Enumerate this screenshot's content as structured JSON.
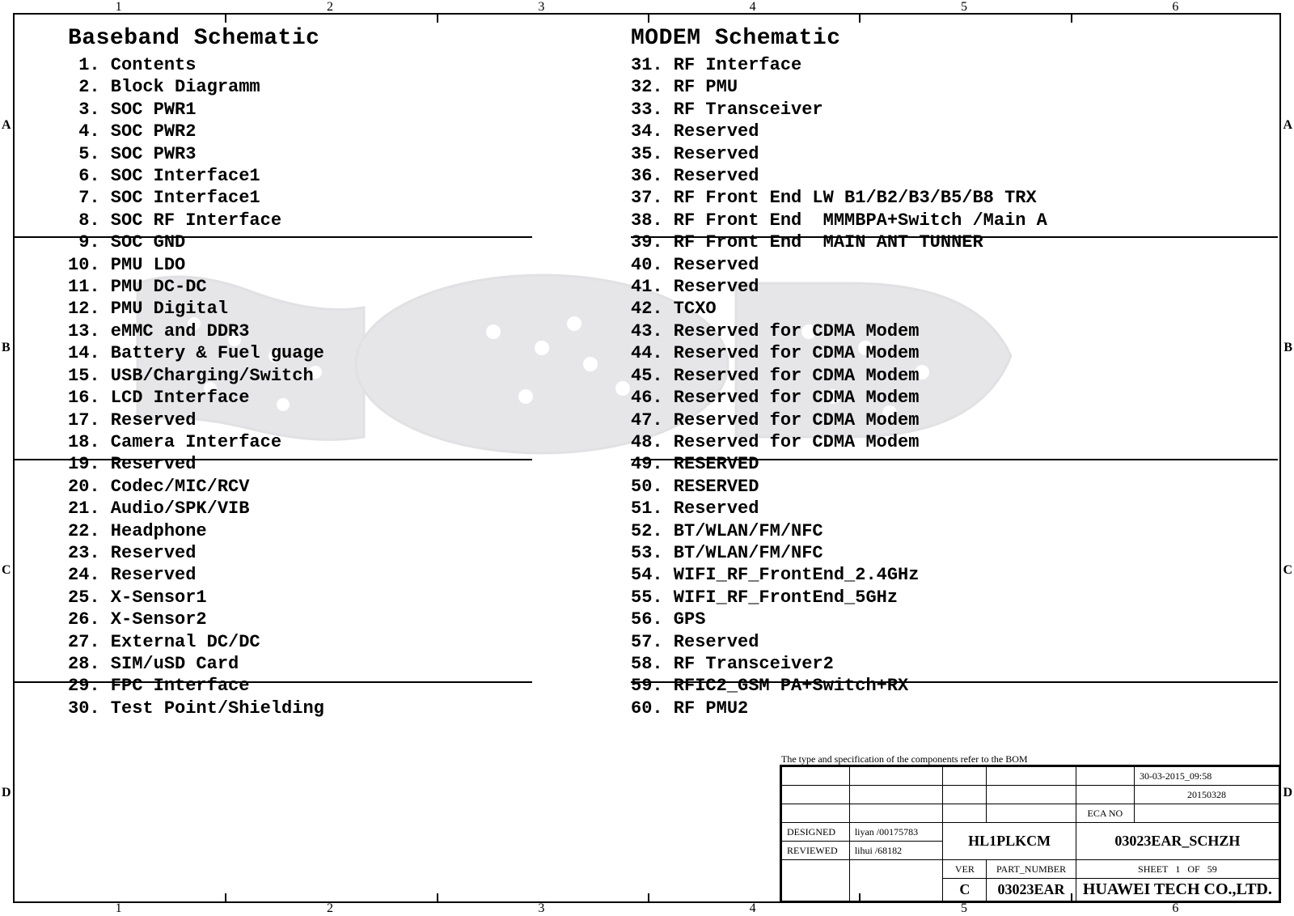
{
  "ruler": {
    "cols": [
      "1",
      "2",
      "3",
      "4",
      "5",
      "6"
    ],
    "rows": [
      "A",
      "B",
      "C",
      "D"
    ]
  },
  "left": {
    "title": "Baseband Schematic",
    "items": [
      "1. Contents",
      "2. Block Diagramm",
      "3. SOC PWR1",
      "4. SOC PWR2",
      "5. SOC PWR3",
      "6. SOC Interface1",
      "7. SOC Interface1",
      "8. SOC RF Interface",
      "9. SOC GND",
      "10. PMU LDO",
      "11. PMU DC-DC",
      "12. PMU Digital",
      "13. eMMC and DDR3",
      "14. Battery & Fuel guage",
      "15. USB/Charging/Switch",
      "16. LCD Interface",
      "17. Reserved",
      "18. Camera Interface",
      "19. Reserved",
      "20. Codec/MIC/RCV",
      "21. Audio/SPK/VIB",
      "22. Headphone",
      "23. Reserved",
      "24. Reserved",
      "25. X-Sensor1",
      "26. X-Sensor2",
      "27. External DC/DC",
      "28. SIM/uSD Card",
      "29. FPC Interface",
      "30. Test Point/Shielding"
    ]
  },
  "right": {
    "title": "MODEM Schematic",
    "items": [
      "31. RF Interface",
      "32. RF PMU",
      "33. RF Transceiver",
      "34. Reserved",
      "35. Reserved",
      "36. Reserved",
      "37. RF Front End LW B1/B2/B3/B5/B8 TRX",
      "38. RF Front End  MMMBPA+Switch /Main A",
      "39. RF Front End  MAIN ANT TUNNER",
      "40. Reserved",
      "41. Reserved",
      "42. TCXO",
      "43. Reserved for CDMA Modem",
      "44. Reserved for CDMA Modem",
      "45. Reserved for CDMA Modem",
      "46. Reserved for CDMA Modem",
      "47. Reserved for CDMA Modem",
      "48. Reserved for CDMA Modem",
      "49. RESERVED",
      "50. RESERVED",
      "51. Reserved",
      "52. BT/WLAN/FM/NFC",
      "53. BT/WLAN/FM/NFC",
      "54. WIFI_RF_FrontEnd_2.4GHz",
      "55. WIFI_RF_FrontEnd_5GHz",
      "56. GPS",
      "57. Reserved",
      "58. RF Transceiver2",
      "59. RFIC2_GSM PA+Switch+RX",
      "60. RF PMU2"
    ]
  },
  "titleblock": {
    "note": "The type and specification of the components  refer to the BOM",
    "timestamp": "30-03-2015_09:58",
    "date": "20150328",
    "eca_label": "ECA NO",
    "designed_label": "DESIGNED",
    "designed_by": "liyan /00175783",
    "reviewed_label": "REVIEWED",
    "reviewed_by": "lihui /68182",
    "board": "HL1PLKCM",
    "doc": "03023EAR_SCHZH",
    "ver_label": "VER",
    "partnum_label": "PART_NUMBER",
    "ver": "C",
    "partnum": "03023EAR",
    "sheet_label": "SHEET",
    "sheet_cur": "1",
    "sheet_of": "OF",
    "sheet_total": "59",
    "company": "HUAWEI TECH CO.,LTD."
  }
}
